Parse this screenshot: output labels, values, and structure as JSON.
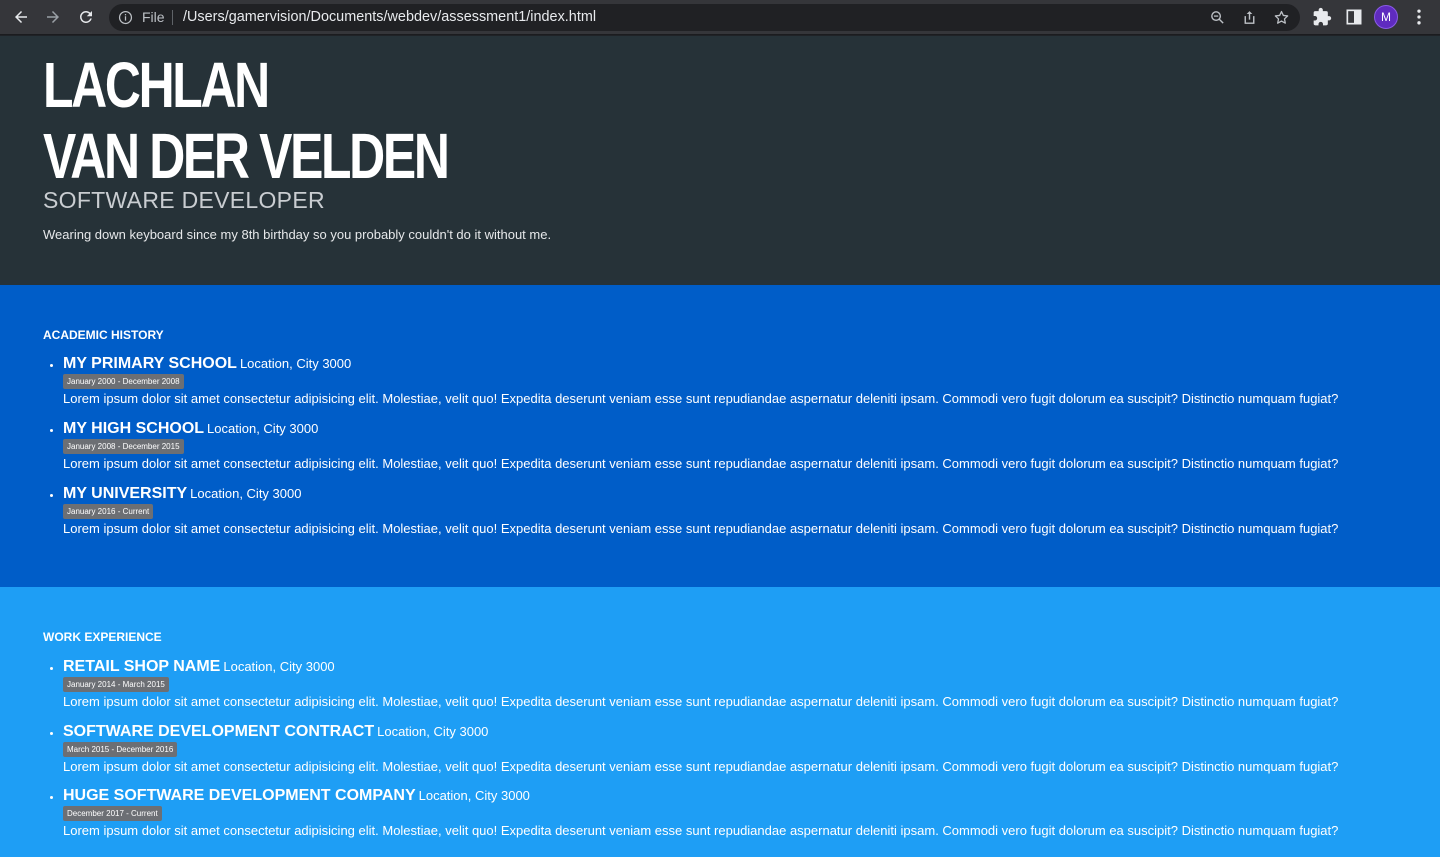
{
  "browser": {
    "file_label": "File",
    "url": "/Users/gamervision/Documents/webdev/assessment1/index.html",
    "avatar_letter": "M",
    "icons": [
      "back-icon",
      "forward-icon",
      "reload-icon",
      "info-icon",
      "zoom-icon",
      "share-icon",
      "star-icon",
      "extensions-icon",
      "sidepanel-icon",
      "menu-icon"
    ]
  },
  "hero": {
    "name_line1": "LACHLAN",
    "name_line2": "VAN DER VELDEN",
    "subtitle": "SOFTWARE DEVELOPER",
    "tagline": "Wearing down keyboard since my 8th birthday so you probably couldn't do it without me."
  },
  "academic": {
    "title": "ACADEMIC HISTORY",
    "items": [
      {
        "name": "MY PRIMARY SCHOOL",
        "location": "Location, City 3000",
        "dates": "January 2000 - December 2008",
        "description": "Lorem ipsum dolor sit amet consectetur adipisicing elit. Molestiae, velit quo! Expedita deserunt veniam esse sunt repudiandae aspernatur deleniti ipsam. Commodi vero fugit dolorum ea suscipit? Distinctio numquam fugiat?"
      },
      {
        "name": "MY HIGH SCHOOL",
        "location": "Location, City 3000",
        "dates": "January 2008 - December 2015",
        "description": "Lorem ipsum dolor sit amet consectetur adipisicing elit. Molestiae, velit quo! Expedita deserunt veniam esse sunt repudiandae aspernatur deleniti ipsam. Commodi vero fugit dolorum ea suscipit? Distinctio numquam fugiat?"
      },
      {
        "name": "MY UNIVERSITY",
        "location": "Location, City 3000",
        "dates": "January 2016 - Current",
        "description": "Lorem ipsum dolor sit amet consectetur adipisicing elit. Molestiae, velit quo! Expedita deserunt veniam esse sunt repudiandae aspernatur deleniti ipsam. Commodi vero fugit dolorum ea suscipit? Distinctio numquam fugiat?"
      }
    ]
  },
  "work": {
    "title": "WORK EXPERIENCE",
    "items": [
      {
        "name": "RETAIL SHOP NAME",
        "location": "Location, City 3000",
        "dates": "January 2014 - March 2015",
        "description": "Lorem ipsum dolor sit amet consectetur adipisicing elit. Molestiae, velit quo! Expedita deserunt veniam esse sunt repudiandae aspernatur deleniti ipsam. Commodi vero fugit dolorum ea suscipit? Distinctio numquam fugiat?"
      },
      {
        "name": "SOFTWARE DEVELOPMENT CONTRACT",
        "location": "Location, City 3000",
        "dates": "March 2015 - December 2016",
        "description": "Lorem ipsum dolor sit amet consectetur adipisicing elit. Molestiae, velit quo! Expedita deserunt veniam esse sunt repudiandae aspernatur deleniti ipsam. Commodi vero fugit dolorum ea suscipit? Distinctio numquam fugiat?"
      },
      {
        "name": "HUGE SOFTWARE DEVELOPMENT COMPANY",
        "location": "Location, City 3000",
        "dates": "December 2017 - Current",
        "description": "Lorem ipsum dolor sit amet consectetur adipisicing elit. Molestiae, velit quo! Expedita deserunt veniam esse sunt repudiandae aspernatur deleniti ipsam. Commodi vero fugit dolorum ea suscipit? Distinctio numquam fugiat?"
      }
    ]
  },
  "colors": {
    "hero_bg": "#263238",
    "academic_bg": "#005dc8",
    "work_bg": "#1e9ef5",
    "badge_bg": "#6c6f74"
  }
}
